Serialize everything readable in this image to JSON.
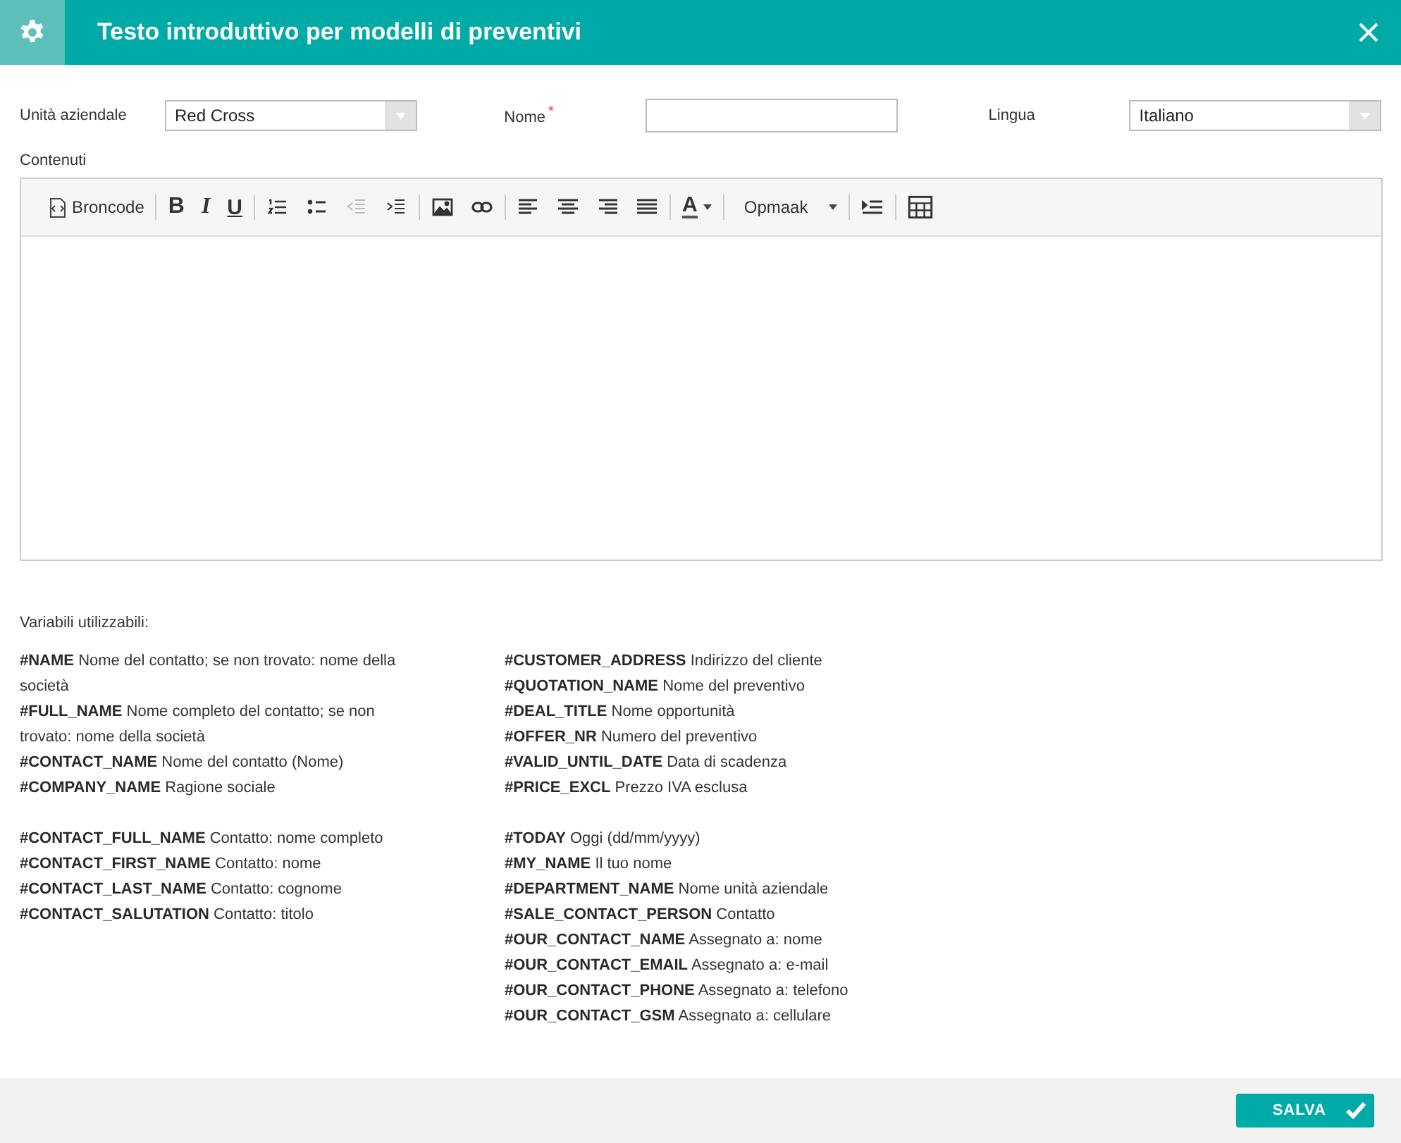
{
  "window": {
    "title": "Testo introduttivo per modelli di preventivi"
  },
  "form": [
    {
      "label": "Unità aziendale",
      "kind": "select",
      "value": "Red Cross",
      "required": false
    },
    {
      "label": "Nome",
      "kind": "text",
      "required": true,
      "required_mark": "*"
    },
    {
      "label": "Lingua",
      "kind": "select",
      "value": "Italiano",
      "required": false
    }
  ],
  "content": {
    "label": "Contenuti",
    "toolbar": [
      {
        "kind": "source",
        "label": "Broncode",
        "disabled": false
      },
      {
        "kind": "separator"
      },
      {
        "kind": "bold",
        "label": "B",
        "disabled": false
      },
      {
        "kind": "italic",
        "label": "I",
        "disabled": false
      },
      {
        "kind": "underline",
        "label": "U",
        "disabled": false
      },
      {
        "kind": "separator"
      },
      {
        "kind": "numbered-list",
        "disabled": false
      },
      {
        "kind": "bullet-list",
        "disabled": false
      },
      {
        "kind": "outdent",
        "disabled": true
      },
      {
        "kind": "indent",
        "disabled": false
      },
      {
        "kind": "separator"
      },
      {
        "kind": "image",
        "disabled": false
      },
      {
        "kind": "link",
        "disabled": false
      },
      {
        "kind": "separator"
      },
      {
        "kind": "align-left",
        "disabled": false
      },
      {
        "kind": "align-center",
        "disabled": false
      },
      {
        "kind": "align-right",
        "disabled": false
      },
      {
        "kind": "justify",
        "disabled": false
      },
      {
        "kind": "separator"
      },
      {
        "kind": "text-color",
        "label": "A",
        "disabled": false
      },
      {
        "kind": "separator"
      },
      {
        "kind": "format",
        "label": "Opmaak",
        "disabled": false
      },
      {
        "kind": "separator"
      },
      {
        "kind": "block",
        "disabled": false
      },
      {
        "kind": "separator"
      },
      {
        "kind": "table",
        "disabled": false
      }
    ]
  },
  "variables": {
    "title": "Variabili utilizzabili:",
    "columns": [
      [
        [
          {
            "variable": "#NAME",
            "description": "Nome del contatto; se non trovato: nome della società"
          },
          {
            "variable": "#FULL_NAME",
            "description": "Nome completo del contatto; se non trovato: nome della società"
          },
          {
            "variable": "#CONTACT_NAME",
            "description": "Nome del contatto (Nome)"
          },
          {
            "variable": "#COMPANY_NAME",
            "description": "Ragione sociale"
          }
        ],
        [
          {
            "variable": "#CONTACT_FULL_NAME",
            "description": "Contatto: nome completo"
          },
          {
            "variable": "#CONTACT_FIRST_NAME",
            "description": "Contatto: nome"
          },
          {
            "variable": "#CONTACT_LAST_NAME",
            "description": "Contatto: cognome"
          },
          {
            "variable": "#CONTACT_SALUTATION",
            "description": "Contatto: titolo"
          }
        ]
      ],
      [
        [
          {
            "variable": "#CUSTOMER_ADDRESS",
            "description": "Indirizzo del cliente"
          },
          {
            "variable": "#QUOTATION_NAME",
            "description": "Nome del preventivo"
          },
          {
            "variable": "#DEAL_TITLE",
            "description": "Nome opportunità"
          },
          {
            "variable": "#OFFER_NR",
            "description": "Numero del preventivo"
          },
          {
            "variable": "#VALID_UNTIL_DATE",
            "description": "Data di scadenza"
          },
          {
            "variable": "#PRICE_EXCL",
            "description": "Prezzo IVA esclusa"
          }
        ],
        [
          {
            "variable": "#TODAY",
            "description": "Oggi (dd/mm/yyyy)"
          },
          {
            "variable": "#MY_NAME",
            "description": "Il tuo nome"
          },
          {
            "variable": "#DEPARTMENT_NAME",
            "description": "Nome unità aziendale"
          },
          {
            "variable": "#SALE_CONTACT_PERSON",
            "description": "Contatto"
          },
          {
            "variable": "#OUR_CONTACT_NAME",
            "description": "Assegnato a: nome"
          },
          {
            "variable": "#OUR_CONTACT_EMAIL",
            "description": "Assegnato a: e-mail"
          },
          {
            "variable": "#OUR_CONTACT_PHONE",
            "description": "Assegnato a: telefono"
          },
          {
            "variable": "#OUR_CONTACT_GSM",
            "description": "Assegnato a: cellulare"
          }
        ]
      ]
    ]
  },
  "footer": {
    "save_label": "SALVA"
  }
}
